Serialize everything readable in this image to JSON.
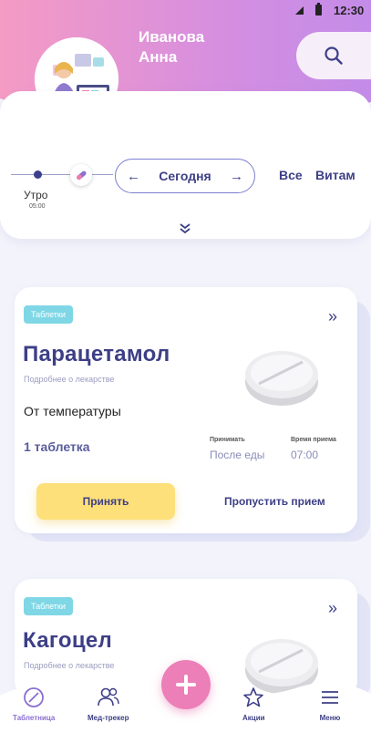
{
  "status_bar": {
    "time": "12:30"
  },
  "header": {
    "last_name": "Иванова",
    "first_name": "Анна",
    "icons": [
      "bell-icon",
      "search-icon"
    ]
  },
  "timeline": {
    "slot_label": "Утро",
    "slot_time": "05:00",
    "date_label": "Сегодня",
    "filters": [
      "Все",
      "Витам"
    ]
  },
  "cards": [
    {
      "category": "Таблетки",
      "name": "Парацетамол",
      "details_link": "Подробнее о лекарстве",
      "purpose": "От температуры",
      "dose": "1 таблетка",
      "take_when_label": "Принимать",
      "take_when_value": "После еды",
      "take_time_label": "Время приема",
      "take_time_value": "07:00",
      "accept_label": "Принять",
      "skip_label": "Пропустить прием"
    },
    {
      "category": "Таблетки",
      "name": "Кагоцел",
      "details_link": "Подробнее о лекарстве"
    }
  ],
  "bottom_nav": {
    "items": [
      {
        "label": "Таблетница",
        "icon": "pill-slash-icon",
        "active": true
      },
      {
        "label": "Мед-трекер",
        "icon": "users-icon",
        "active": false
      },
      {
        "label": "Акции",
        "icon": "star-icon",
        "active": false
      },
      {
        "label": "Меню",
        "icon": "menu-icon",
        "active": false
      }
    ],
    "add_icon": "plus-icon"
  },
  "colors": {
    "accent": "#3d3f86",
    "header_gradient_start": "#f29bc7",
    "header_gradient_end": "#c18ce6",
    "badge": "#7fd7e6",
    "accept_button": "#fde07a",
    "add_button": "#ec7fb7"
  }
}
